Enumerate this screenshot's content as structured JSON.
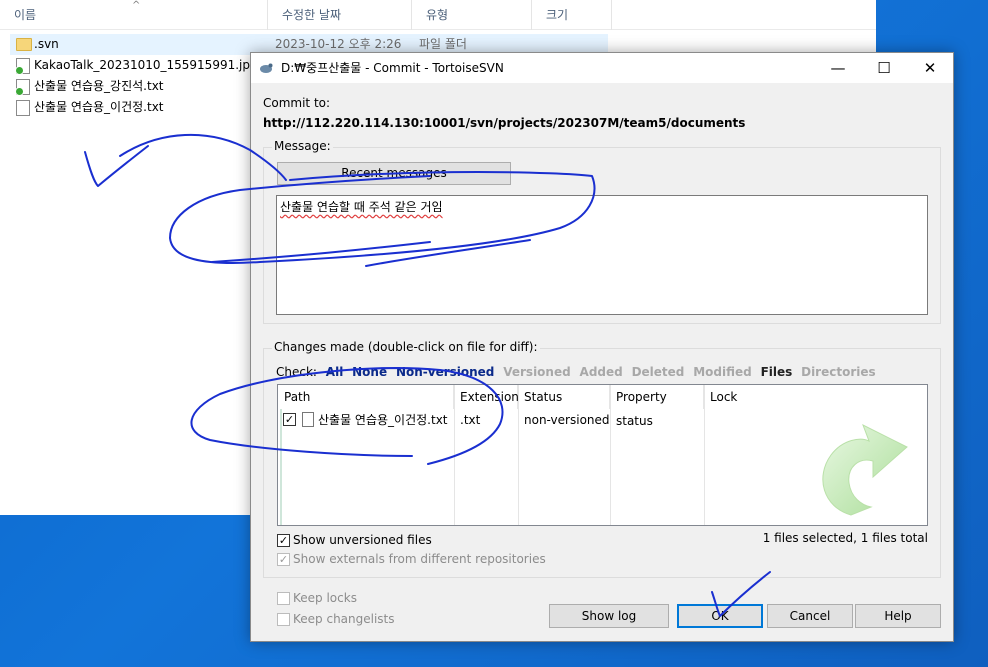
{
  "explorer": {
    "columns": {
      "name": "이름",
      "date": "수정한 날짜",
      "type": "유형",
      "size": "크기"
    },
    "sort_arrow": "^",
    "files": [
      {
        "name": ".svn",
        "date": "2023-10-12 오후 2:26",
        "type": "파일 폴더",
        "icon": "folder-icon"
      },
      {
        "name": "KakaoTalk_20231010_155915991.jpg",
        "date": "",
        "type": "",
        "icon": "svn-normal-image-icon"
      },
      {
        "name": "산출물 연습용_강진석.txt",
        "date": "",
        "type": "",
        "icon": "svn-normal-text-icon"
      },
      {
        "name": "산출물 연습용_이건정.txt",
        "date": "",
        "type": "",
        "icon": "text-file-icon"
      }
    ]
  },
  "dialog": {
    "title": "D:₩중프산출물 - Commit - TortoiseSVN",
    "controls": {
      "minimize": "—",
      "maximize": "☐",
      "close": "✕"
    },
    "commit_to_label": "Commit to:",
    "commit_url": "http://112.220.114.130:10001/svn/projects/202307M/team5/documents",
    "message_group_label": "Message:",
    "recent_messages_button": "Recent messages",
    "message_text": "산출물 연습할 때 주석 같은 거임",
    "changes_group_label": "Changes made (double-click on file for diff):",
    "check_label": "Check:",
    "check_filters": [
      {
        "label": "All",
        "state": "on"
      },
      {
        "label": "None",
        "state": "on"
      },
      {
        "label": "Non-versioned",
        "state": "on"
      },
      {
        "label": "Versioned",
        "state": "off"
      },
      {
        "label": "Added",
        "state": "off"
      },
      {
        "label": "Deleted",
        "state": "off"
      },
      {
        "label": "Modified",
        "state": "off"
      },
      {
        "label": "Files",
        "state": "dark"
      },
      {
        "label": "Directories",
        "state": "off"
      }
    ],
    "list_columns": {
      "path": "Path",
      "extension": "Extension",
      "status": "Status",
      "property_status": "Property status",
      "lock": "Lock"
    },
    "list_rows": [
      {
        "checked": true,
        "path": "산출물 연습용_이건정.txt",
        "extension": ".txt",
        "status": "non-versioned",
        "property_status": "",
        "lock": ""
      }
    ],
    "show_unversioned": {
      "label": "Show unversioned files",
      "checked": true
    },
    "show_externals": {
      "label": "Show externals from different repositories",
      "checked": true
    },
    "selection_summary": "1 files selected, 1 files total",
    "keep_locks": {
      "label": "Keep locks",
      "checked": false
    },
    "keep_changelists": {
      "label": "Keep changelists",
      "checked": false
    },
    "buttons": {
      "show_log": "Show log",
      "ok": "OK",
      "cancel": "Cancel",
      "help": "Help"
    }
  },
  "colors": {
    "accent": "#0078d7",
    "ink": "#1a2fd0",
    "svn_green": "#3aa835"
  }
}
